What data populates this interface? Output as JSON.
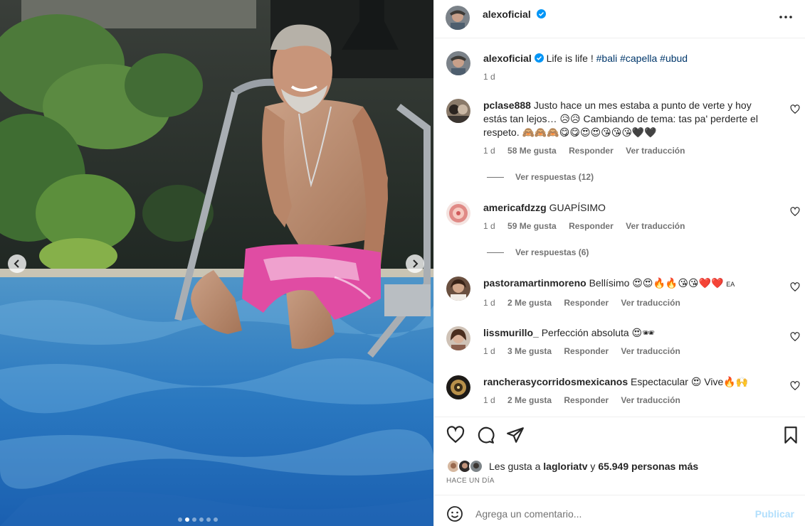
{
  "post": {
    "author": "alexoficial",
    "caption_text": "Life is life !",
    "hashtags": [
      "#bali",
      "#capella",
      "#ubud"
    ],
    "caption_time": "1 d"
  },
  "comments": [
    {
      "user": "pclase888",
      "text": "Justo hace un mes estaba a punto de verte y hoy estás tan lejos… 😥😥 Cambiando de tema: tas pa' perderte el respeto. 🙈🙈🙈😋😋😍😍😘😘😘🖤🖤",
      "time": "1 d",
      "likes": "58 Me gusta",
      "reply": "Responder",
      "translate": "Ver traducción",
      "view_replies": "Ver respuestas (12)"
    },
    {
      "user": "americafdzzg",
      "text": "GUAPÍSIMO",
      "time": "1 d",
      "likes": "59 Me gusta",
      "reply": "Responder",
      "translate": "Ver traducción",
      "view_replies": "Ver respuestas (6)"
    },
    {
      "user": "pastoramartinmoreno",
      "text": "Bellísimo 😍😍🔥🔥😘😘❤️❤️",
      "suffix": "EA",
      "time": "1 d",
      "likes": "2 Me gusta",
      "reply": "Responder",
      "translate": "Ver traducción"
    },
    {
      "user": "lissmurillo_",
      "text": "Perfección absoluta 😍🕶",
      "time": "1 d",
      "likes": "3 Me gusta",
      "reply": "Responder",
      "translate": "Ver traducción"
    },
    {
      "user": "rancherasycorridosmexicanos",
      "text": "Espectacular 😍 Vive🔥🙌",
      "time": "1 d",
      "likes": "2 Me gusta",
      "reply": "Responder",
      "translate": "Ver traducción"
    }
  ],
  "likes_line": {
    "prefix": "Les gusta a",
    "user": "lagloriatv",
    "and": "y",
    "count": "65.949 personas más"
  },
  "posted_ago": "HACE UN DÍA",
  "add_comment": {
    "placeholder": "Agrega un comentario...",
    "publish": "Publicar"
  },
  "icons": {
    "more": "more-horizontal-icon",
    "like": "heart-icon",
    "comment": "comment-icon",
    "share": "share-icon",
    "save": "bookmark-icon",
    "emoji": "smile-icon",
    "verified": "verified-badge-icon"
  },
  "colors": {
    "link": "#00376b",
    "muted": "#737373",
    "publish_disabled": "#b2dffc",
    "verified": "#0095f6"
  },
  "carousel": {
    "total": 6,
    "active": 1
  }
}
